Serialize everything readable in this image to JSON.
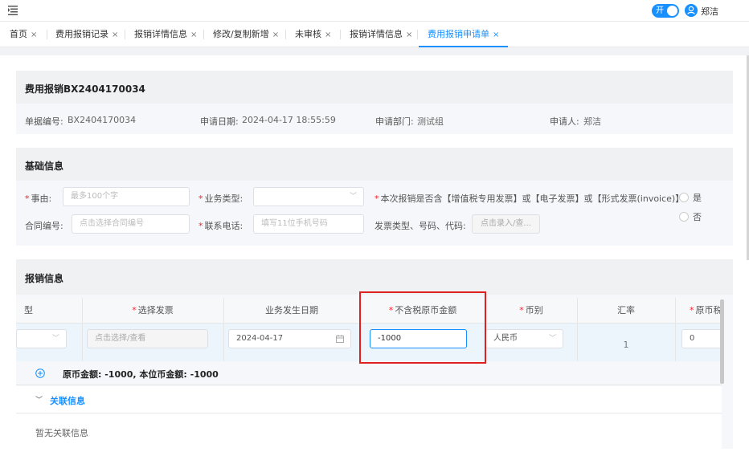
{
  "topbar": {
    "toggle_label": "开",
    "user_name": "郑洁"
  },
  "tabs": [
    {
      "label": "首页"
    },
    {
      "label": "费用报销记录"
    },
    {
      "label": "报销详情信息"
    },
    {
      "label": "修改/复制新增"
    },
    {
      "label": "未审核"
    },
    {
      "label": "报销详情信息"
    },
    {
      "label": "费用报销申请单",
      "active": true
    }
  ],
  "tab_close": "×",
  "header": {
    "title": "费用报销BX2404170034",
    "doc_no_label": "单据编号:",
    "doc_no": "BX2404170034",
    "apply_date_label": "申请日期:",
    "apply_date": "2024-04-17 18:55:59",
    "dept_label": "申请部门:",
    "dept": "测试组",
    "applicant_label": "申请人:",
    "applicant": "郑洁"
  },
  "basic": {
    "title": "基础信息",
    "reason_label": "事由:",
    "reason_placeholder": "最多100个字",
    "biz_type_label": "业务类型:",
    "invoice_question": "本次报销是否含【增值税专用发票】或【电子发票】或【形式发票(invoice)】:",
    "yes": "是",
    "no": "否",
    "contract_label": "合同编号:",
    "contract_placeholder": "点击选择合同编号",
    "phone_label": "联系电话:",
    "phone_placeholder": "填写11位手机号码",
    "invoice_info_label": "发票类型、号码、代码:",
    "invoice_entry_button": "点击录入/查..."
  },
  "reimb": {
    "title": "报销信息",
    "columns": {
      "partial_first": "型",
      "select_invoice": "选择发票",
      "biz_date": "业务发生日期",
      "amount_excl_tax": "不含税原币金额",
      "currency": "币别",
      "rate": "汇率",
      "orig_tax": "原币税额"
    },
    "required_mark": "*",
    "row": {
      "select_invoice_placeholder": "点击选择/查看",
      "biz_date": "2024-04-17",
      "amount": "-1000",
      "currency": "人民币",
      "rate": "1",
      "orig_tax": "0"
    },
    "summary": "原币金额: -1000, 本位币金额: -1000",
    "related_title": "关联信息",
    "related_empty": "暂无关联信息"
  },
  "colors": {
    "primary": "#1890ff",
    "required": "#f5222d",
    "highlight_box": "#e02020"
  }
}
